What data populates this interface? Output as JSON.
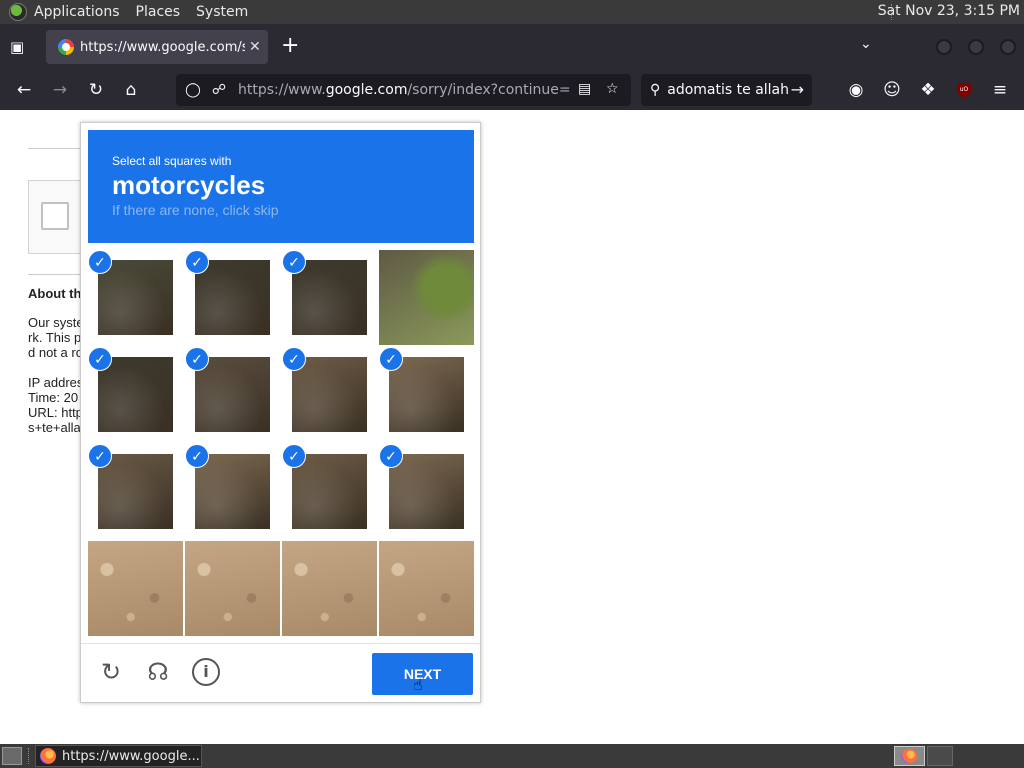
{
  "topbar": {
    "menus": [
      "Applications",
      "Places",
      "System"
    ],
    "clock": "Sat Nov 23,  3:15 PM"
  },
  "browser": {
    "tab_title": "https://www.google.com/sorry",
    "url_prefix": "https://www.",
    "url_domain": "google.com",
    "url_rest": "/sorry/index?continue=https",
    "search_text": "adomatis te allah"
  },
  "page": {
    "about": "About th",
    "lines": [
      "Our syste",
      "rk. This p",
      "d not a ro",
      "IP addres",
      "Time: 20",
      "URL: http",
      "s+te+alla"
    ]
  },
  "captcha": {
    "instruction": "Select all squares with",
    "object": "motorcycles",
    "hint": "If there are none, click skip",
    "next_label": "NEXT",
    "tiles": [
      {
        "selected": true,
        "tone": "dark-bush"
      },
      {
        "selected": true,
        "tone": "dark-bike"
      },
      {
        "selected": true,
        "tone": "dark-bike"
      },
      {
        "selected": false,
        "tone": "grass"
      },
      {
        "selected": true,
        "tone": "dark-bike"
      },
      {
        "selected": true,
        "tone": "rider"
      },
      {
        "selected": true,
        "tone": "wheel"
      },
      {
        "selected": true,
        "tone": "wheel-dirt"
      },
      {
        "selected": true,
        "tone": "dirt-dark"
      },
      {
        "selected": true,
        "tone": "wheel-dirt"
      },
      {
        "selected": true,
        "tone": "wheel"
      },
      {
        "selected": true,
        "tone": "wheel-dirt"
      },
      {
        "selected": false,
        "tone": "dirt"
      },
      {
        "selected": false,
        "tone": "dirt"
      },
      {
        "selected": false,
        "tone": "dirt"
      },
      {
        "selected": false,
        "tone": "dirt"
      }
    ],
    "tone_colors": {
      "dark-bush": "#4a4a38",
      "dark-bike": "#3e3a2e",
      "grass": "#7a8456",
      "rider": "#5a4e3e",
      "wheel": "#6e5c46",
      "wheel-dirt": "#7d6a52",
      "dirt-dark": "#6a5a46",
      "dirt": "#b59a78"
    },
    "accent": "#1a73e8"
  },
  "taskbar": {
    "window_title": "https://www.google..."
  }
}
